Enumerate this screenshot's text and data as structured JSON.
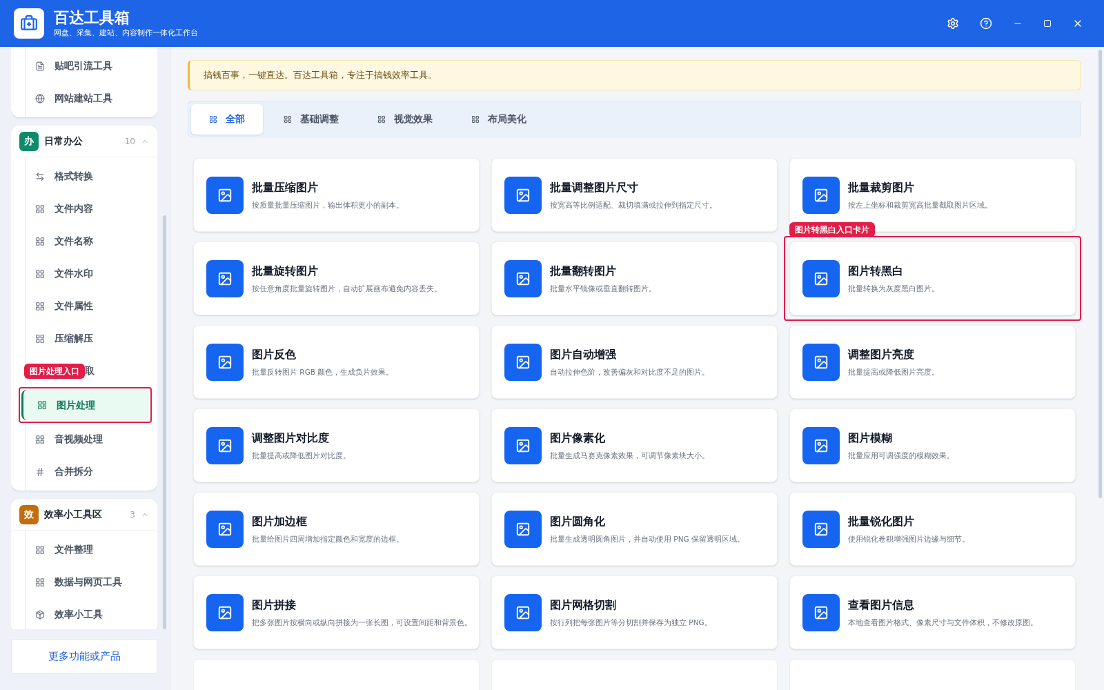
{
  "app": {
    "title": "百达工具箱",
    "subtitle": "网盘、采集、建站、内容制作一体化工作台"
  },
  "sidebar": {
    "groups": [
      {
        "items": [
          {
            "label": "贴吧引流工具",
            "kind": "doc",
            "selected": false
          },
          {
            "label": "网站建站工具",
            "kind": "globe",
            "selected": false
          }
        ]
      },
      {
        "badge": "办",
        "color": "#0f8a6a",
        "title": "日常办公",
        "count": "10",
        "expanded": true,
        "items": [
          {
            "label": "格式转换",
            "kind": "swap",
            "selected": false
          },
          {
            "label": "文件内容",
            "kind": "grid",
            "selected": false
          },
          {
            "label": "文件名称",
            "kind": "grid",
            "selected": false
          },
          {
            "label": "文件水印",
            "kind": "grid",
            "selected": false
          },
          {
            "label": "文件属性",
            "kind": "grid",
            "selected": false
          },
          {
            "label": "压缩解压",
            "kind": "grid",
            "selected": false
          },
          {
            "label": "取",
            "kind": "covered",
            "selected": false,
            "callout": "图片处理入口"
          },
          {
            "label": "图片处理",
            "kind": "grid",
            "selected": true
          },
          {
            "label": "音视频处理",
            "kind": "grid",
            "selected": false
          },
          {
            "label": "合并拆分",
            "kind": "hash",
            "selected": false
          }
        ]
      },
      {
        "badge": "效",
        "color": "#c26d0e",
        "title": "效率小工具区",
        "count": "3",
        "expanded": true,
        "items": [
          {
            "label": "文件整理",
            "kind": "grid",
            "selected": false
          },
          {
            "label": "数据与网页工具",
            "kind": "grid",
            "selected": false
          },
          {
            "label": "效率小工具",
            "kind": "box",
            "selected": false
          }
        ]
      }
    ],
    "more_link": "更多功能或产品"
  },
  "notice": "搞钱百事，一键直达。百达工具箱，专注于搞钱效率工具。",
  "tabs": [
    {
      "label": "全部",
      "selected": true
    },
    {
      "label": "基础调整",
      "selected": false
    },
    {
      "label": "视觉效果",
      "selected": false
    },
    {
      "label": "布局美化",
      "selected": false
    }
  ],
  "cards": [
    {
      "title": "批量压缩图片",
      "desc": "按质量批量压缩图片，输出体积更小的副本。"
    },
    {
      "title": "批量调整图片尺寸",
      "desc": "按宽高等比例适配、裁切填满或拉伸到指定尺寸。"
    },
    {
      "title": "批量裁剪图片",
      "desc": "按左上坐标和裁剪宽高批量截取图片区域。"
    },
    {
      "title": "批量旋转图片",
      "desc": "按任意角度批量旋转图片，自动扩展画布避免内容丢失。"
    },
    {
      "title": "批量翻转图片",
      "desc": "批量水平镜像或垂直翻转图片。"
    },
    {
      "title": "图片转黑白",
      "desc": "批量转换为灰度黑白图片。",
      "callout": "图片转黑白入口卡片"
    },
    {
      "title": "图片反色",
      "desc": "批量反转图片 RGB 颜色，生成负片效果。"
    },
    {
      "title": "图片自动增强",
      "desc": "自动拉伸色阶，改善偏灰和对比度不足的图片。"
    },
    {
      "title": "调整图片亮度",
      "desc": "批量提高或降低图片亮度。"
    },
    {
      "title": "调整图片对比度",
      "desc": "批量提高或降低图片对比度。"
    },
    {
      "title": "图片像素化",
      "desc": "批量生成马赛克像素效果，可调节像素块大小。"
    },
    {
      "title": "图片模糊",
      "desc": "批量应用可调强度的模糊效果。"
    },
    {
      "title": "图片加边框",
      "desc": "批量给图片四周增加指定颜色和宽度的边框。"
    },
    {
      "title": "图片圆角化",
      "desc": "批量生成透明圆角图片，并自动使用 PNG 保留透明区域。"
    },
    {
      "title": "批量锐化图片",
      "desc": "使用锐化卷积增强图片边缘与细节。"
    },
    {
      "title": "图片拼接",
      "desc": "把多张图片按横向或纵向拼接为一张长图，可设置间距和背景色。"
    },
    {
      "title": "图片网格切割",
      "desc": "按行列把每张图片等分切割并保存为独立 PNG。"
    },
    {
      "title": "查看图片信息",
      "desc": "本地查看图片格式、像素尺寸与文件体积，不修改原图。"
    },
    {
      "kind": "blank"
    },
    {
      "kind": "blank"
    },
    {
      "kind": "blank"
    }
  ]
}
